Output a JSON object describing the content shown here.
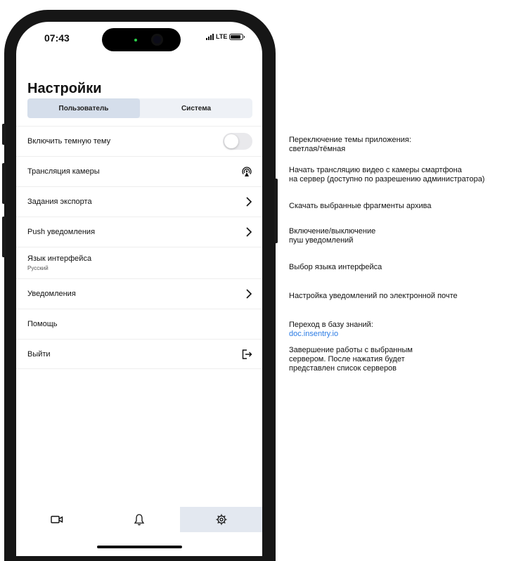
{
  "status_bar": {
    "time": "07:43",
    "network": "LTE"
  },
  "page": {
    "title": "Настройки"
  },
  "segmented": {
    "tabs": [
      "Пользователь",
      "Система"
    ],
    "active_index": 0
  },
  "settings": [
    {
      "label": "Включить темную тему",
      "control": "toggle",
      "toggle_on": false
    },
    {
      "label": "Трансляция камеры",
      "control": "broadcast-icon"
    },
    {
      "label": "Задания экспорта",
      "control": "chevron-right-icon"
    },
    {
      "label": "Push уведомления",
      "control": "chevron-right-icon"
    },
    {
      "label": "Язык интерфейса",
      "value": "Русский"
    },
    {
      "label": "Уведомления",
      "control": "chevron-right-icon"
    },
    {
      "label": "Помощь"
    },
    {
      "label": "Выйти",
      "control": "logout-icon"
    }
  ],
  "tab_bar": {
    "items": [
      {
        "icon": "video-camera-icon"
      },
      {
        "icon": "bell-icon"
      },
      {
        "icon": "gear-icon"
      }
    ],
    "active_index": 2
  },
  "annotations": {
    "dark_theme": [
      "Переключение темы приложения:",
      "светлая/тёмная"
    ],
    "camera": [
      "Начать трансляцию видео с камеры смартфона",
      "на сервер (доступно по разрешению администратора)"
    ],
    "export": [
      "Скачать выбранные фрагменты архива"
    ],
    "push": [
      "Включение/выключение",
      "пуш уведомлений"
    ],
    "language": [
      "Выбор языка интерфейса"
    ],
    "notifications": [
      "Настройка уведомлений по электронной почте"
    ],
    "help": [
      "Переход в базу знаний:"
    ],
    "help_link": "doc.insentry.io",
    "logout": [
      "Завершение работы с выбранным",
      "сервером. После нажатия будет",
      "представлен список серверов"
    ]
  },
  "colors": {
    "link": "#2a7be4",
    "segment_active": "#d5deeb",
    "tab_active": "#e3e8f0"
  }
}
